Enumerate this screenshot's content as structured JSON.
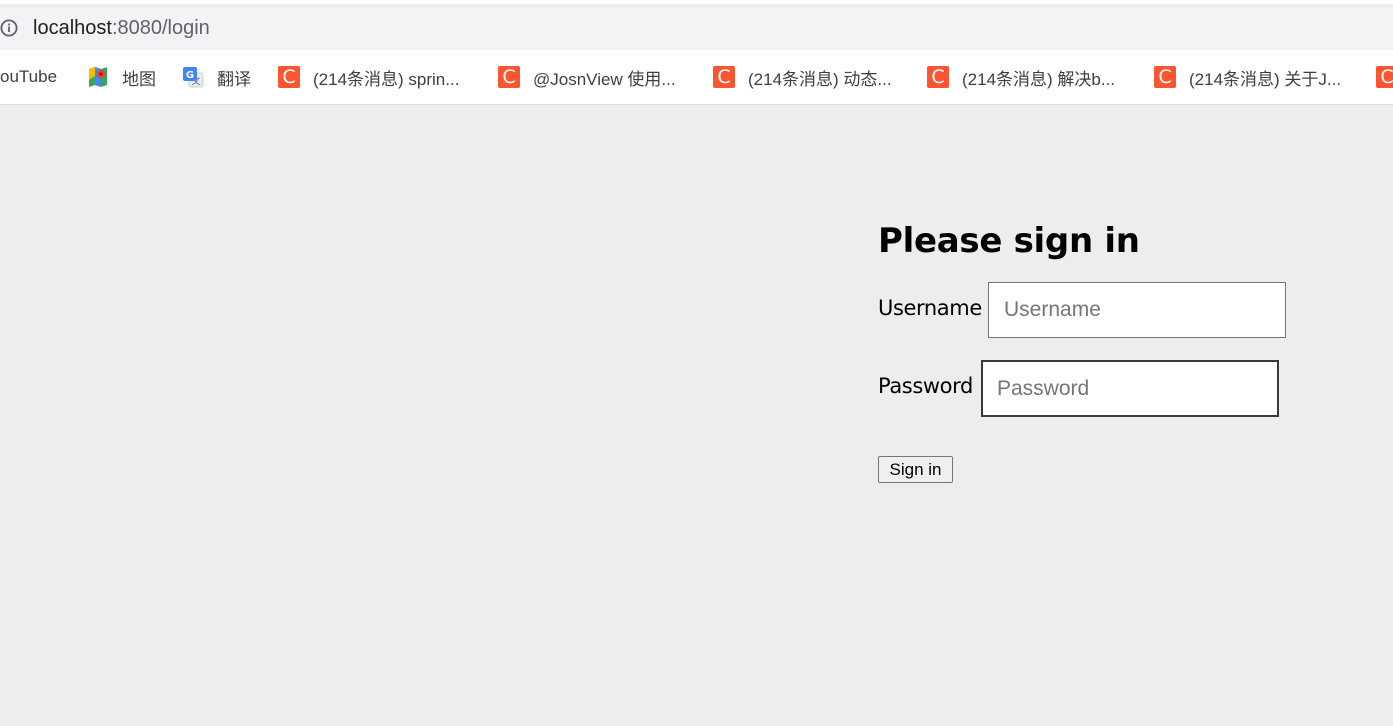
{
  "address_bar": {
    "url_host": "localhost",
    "url_path": ":8080/login",
    "info_icon": "info-icon"
  },
  "bookmarks": [
    {
      "label": "ouTube",
      "icon": "none"
    },
    {
      "label": "地图",
      "icon": "google-maps-icon"
    },
    {
      "label": "翻译",
      "icon": "google-translate-icon"
    },
    {
      "label": "(214条消息) sprin...",
      "icon": "csdn-c-icon"
    },
    {
      "label": "@JosnView 使用...",
      "icon": "csdn-c-icon"
    },
    {
      "label": "(214条消息) 动态...",
      "icon": "csdn-c-icon"
    },
    {
      "label": "(214条消息) 解决b...",
      "icon": "csdn-c-icon"
    },
    {
      "label": "(214条消息) 关于J...",
      "icon": "csdn-c-icon"
    }
  ],
  "login": {
    "heading": "Please sign in",
    "username_label": "Username",
    "username_placeholder": "Username",
    "password_label": "Password",
    "password_placeholder": "Password",
    "submit_label": "Sign in"
  },
  "colors": {
    "csdn_brand": "#fc5531",
    "page_background": "#ededed",
    "address_bar_background": "#f1f3f4"
  }
}
